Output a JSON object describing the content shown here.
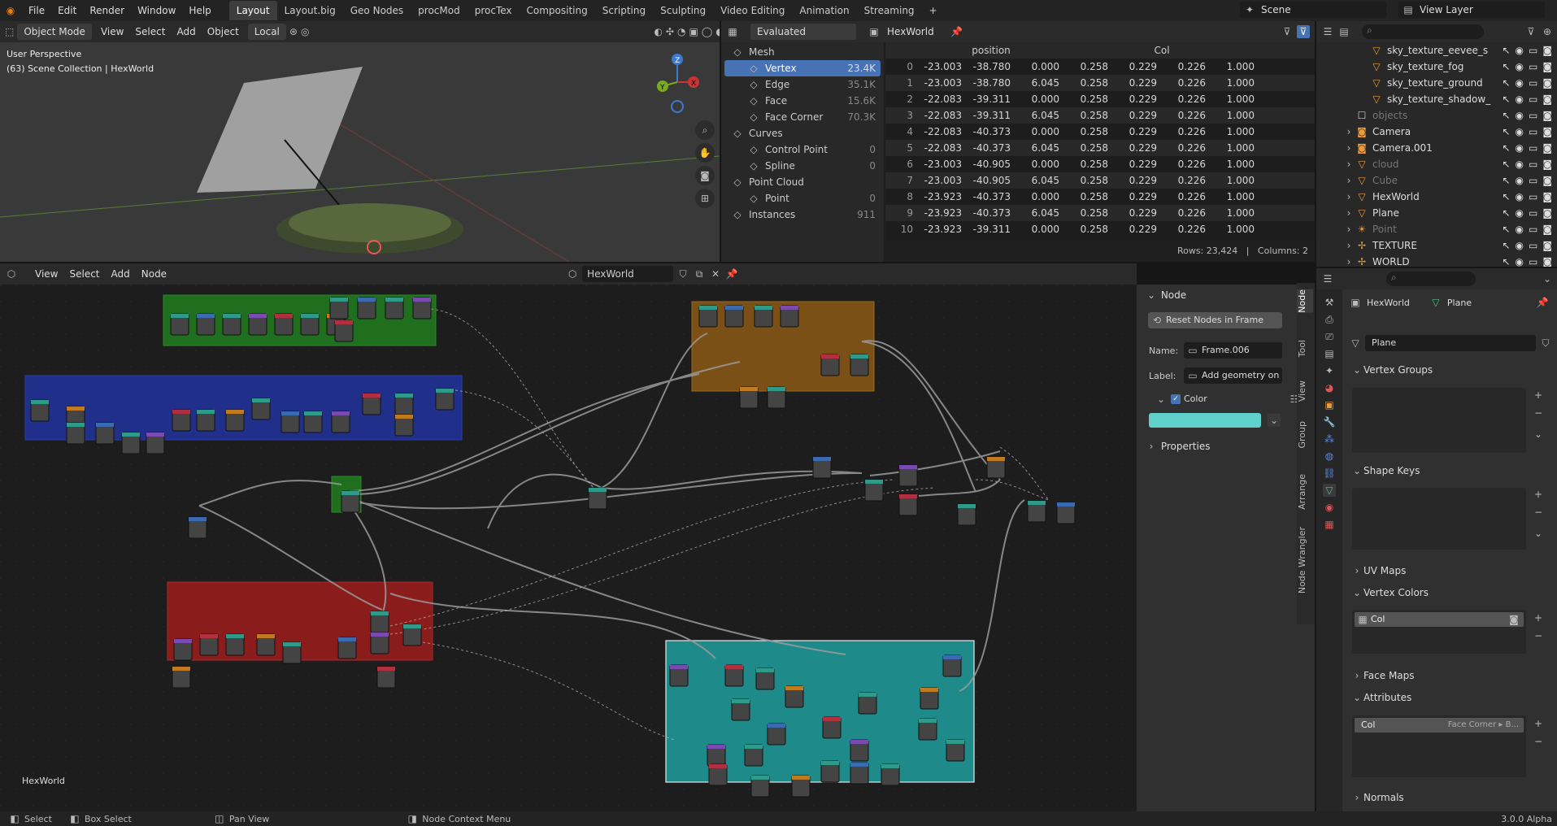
{
  "topbar": {
    "menus": [
      "File",
      "Edit",
      "Render",
      "Window",
      "Help"
    ],
    "workspaces": [
      "Layout",
      "Layout.big",
      "Geo Nodes",
      "procMod",
      "procTex",
      "Compositing",
      "Scripting",
      "Sculpting",
      "Video Editing",
      "Animation",
      "Streaming"
    ],
    "active_workspace": "Layout",
    "add_tab": "+",
    "scene": "Scene",
    "view_layer": "View Layer"
  },
  "viewport": {
    "mode": "Object Mode",
    "menus": [
      "View",
      "Select",
      "Add",
      "Object"
    ],
    "orientation": "Local",
    "overlay_title": "User Perspective",
    "overlay_sub": "(63) Scene Collection | HexWorld",
    "gizmo": {
      "x": "X",
      "y": "Y",
      "z": "Z"
    }
  },
  "spreadsheet": {
    "evaluated": "Evaluated",
    "object": "HexWorld",
    "tree": [
      {
        "label": "Mesh",
        "count": "",
        "level": 0,
        "icon": "mesh-icon"
      },
      {
        "label": "Vertex",
        "count": "23.4K",
        "level": 1,
        "active": true,
        "icon": "vertex-icon"
      },
      {
        "label": "Edge",
        "count": "35.1K",
        "level": 1,
        "icon": "edge-icon"
      },
      {
        "label": "Face",
        "count": "15.6K",
        "level": 1,
        "icon": "face-icon"
      },
      {
        "label": "Face Corner",
        "count": "70.3K",
        "level": 1,
        "icon": "face-corner-icon"
      },
      {
        "label": "Curves",
        "count": "",
        "level": 0,
        "icon": "curve-icon"
      },
      {
        "label": "Control Point",
        "count": "0",
        "level": 1,
        "icon": "control-point-icon"
      },
      {
        "label": "Spline",
        "count": "0",
        "level": 1,
        "icon": "spline-icon"
      },
      {
        "label": "Point Cloud",
        "count": "",
        "level": 0,
        "icon": "point-cloud-icon"
      },
      {
        "label": "Point",
        "count": "0",
        "level": 1,
        "icon": "point-icon"
      },
      {
        "label": "Instances",
        "count": "911",
        "level": 0,
        "icon": "instances-icon"
      }
    ],
    "columns": [
      "position",
      "Col"
    ],
    "rows": [
      [
        "0",
        "-23.003",
        "-38.780",
        "0.000",
        "0.258",
        "0.229",
        "0.226",
        "1.000"
      ],
      [
        "1",
        "-23.003",
        "-38.780",
        "6.045",
        "0.258",
        "0.229",
        "0.226",
        "1.000"
      ],
      [
        "2",
        "-22.083",
        "-39.311",
        "0.000",
        "0.258",
        "0.229",
        "0.226",
        "1.000"
      ],
      [
        "3",
        "-22.083",
        "-39.311",
        "6.045",
        "0.258",
        "0.229",
        "0.226",
        "1.000"
      ],
      [
        "4",
        "-22.083",
        "-40.373",
        "0.000",
        "0.258",
        "0.229",
        "0.226",
        "1.000"
      ],
      [
        "5",
        "-22.083",
        "-40.373",
        "6.045",
        "0.258",
        "0.229",
        "0.226",
        "1.000"
      ],
      [
        "6",
        "-23.003",
        "-40.905",
        "0.000",
        "0.258",
        "0.229",
        "0.226",
        "1.000"
      ],
      [
        "7",
        "-23.003",
        "-40.905",
        "6.045",
        "0.258",
        "0.229",
        "0.226",
        "1.000"
      ],
      [
        "8",
        "-23.923",
        "-40.373",
        "0.000",
        "0.258",
        "0.229",
        "0.226",
        "1.000"
      ],
      [
        "9",
        "-23.923",
        "-40.373",
        "6.045",
        "0.258",
        "0.229",
        "0.226",
        "1.000"
      ],
      [
        "10",
        "-23.923",
        "-39.311",
        "0.000",
        "0.258",
        "0.229",
        "0.226",
        "1.000"
      ]
    ],
    "footer": "Rows: 23,424   |   Columns: 2"
  },
  "outliner": {
    "items": [
      {
        "label": "sky_texture_eevee_s",
        "level": 2,
        "dim": false,
        "kind": "node"
      },
      {
        "label": "sky_texture_fog",
        "level": 2,
        "kind": "node"
      },
      {
        "label": "sky_texture_ground",
        "level": 2,
        "kind": "node"
      },
      {
        "label": "sky_texture_shadow_",
        "level": 2,
        "kind": "node"
      },
      {
        "label": "objects",
        "level": 1,
        "kind": "collection",
        "dim": true
      },
      {
        "label": "Camera",
        "level": 1,
        "kind": "camera"
      },
      {
        "label": "Camera.001",
        "level": 1,
        "kind": "camera"
      },
      {
        "label": "cloud",
        "level": 1,
        "kind": "mesh",
        "dim": true
      },
      {
        "label": "Cube",
        "level": 1,
        "kind": "mesh",
        "dim": true
      },
      {
        "label": "HexWorld",
        "level": 1,
        "kind": "mesh"
      },
      {
        "label": "Plane",
        "level": 1,
        "kind": "mesh"
      },
      {
        "label": "Point",
        "level": 1,
        "kind": "light",
        "dim": true
      },
      {
        "label": "TEXTURE",
        "level": 1,
        "kind": "empty"
      },
      {
        "label": "WORLD",
        "level": 1,
        "kind": "empty"
      }
    ]
  },
  "node_editor": {
    "menus": [
      "View",
      "Select",
      "Add",
      "Node"
    ],
    "tree_name": "HexWorld",
    "tree_label": "HexWorld"
  },
  "node_panel": {
    "title": "Node",
    "reset_btn": "Reset Nodes in Frame",
    "name_label": "Name:",
    "name_value": "Frame.006",
    "label_label": "Label:",
    "label_value": "Add geometry on ...",
    "color_label": "Color",
    "color_value": "#5fd0cc",
    "properties": "Properties",
    "side_tabs": [
      "Node",
      "Tool",
      "View",
      "Group",
      "Arrange",
      "Node Wrangler"
    ]
  },
  "properties": {
    "object": "HexWorld",
    "data": "Plane",
    "mesh_name": "Plane",
    "sections": {
      "vertex_groups": "Vertex Groups",
      "shape_keys": "Shape Keys",
      "uv_maps": "UV Maps",
      "vertex_colors": "Vertex Colors",
      "face_maps": "Face Maps",
      "attributes": "Attributes",
      "normals": "Normals"
    },
    "vertex_color_item": "Col",
    "attribute_name": "Col",
    "attribute_domain": "Face Corner ▸ B..."
  },
  "statusbar": {
    "select": "Select",
    "box_select": "Box Select",
    "pan_view": "Pan View",
    "context": "Node Context Menu",
    "version": "3.0.0 Alpha"
  },
  "colors": {
    "accent": "#4772b3",
    "frame_green": "#1f6f1f",
    "frame_blue": "#1f2f8a",
    "frame_red": "#8a1c1c",
    "frame_orange": "#7a5016",
    "frame_teal": "#1f8a8a"
  }
}
